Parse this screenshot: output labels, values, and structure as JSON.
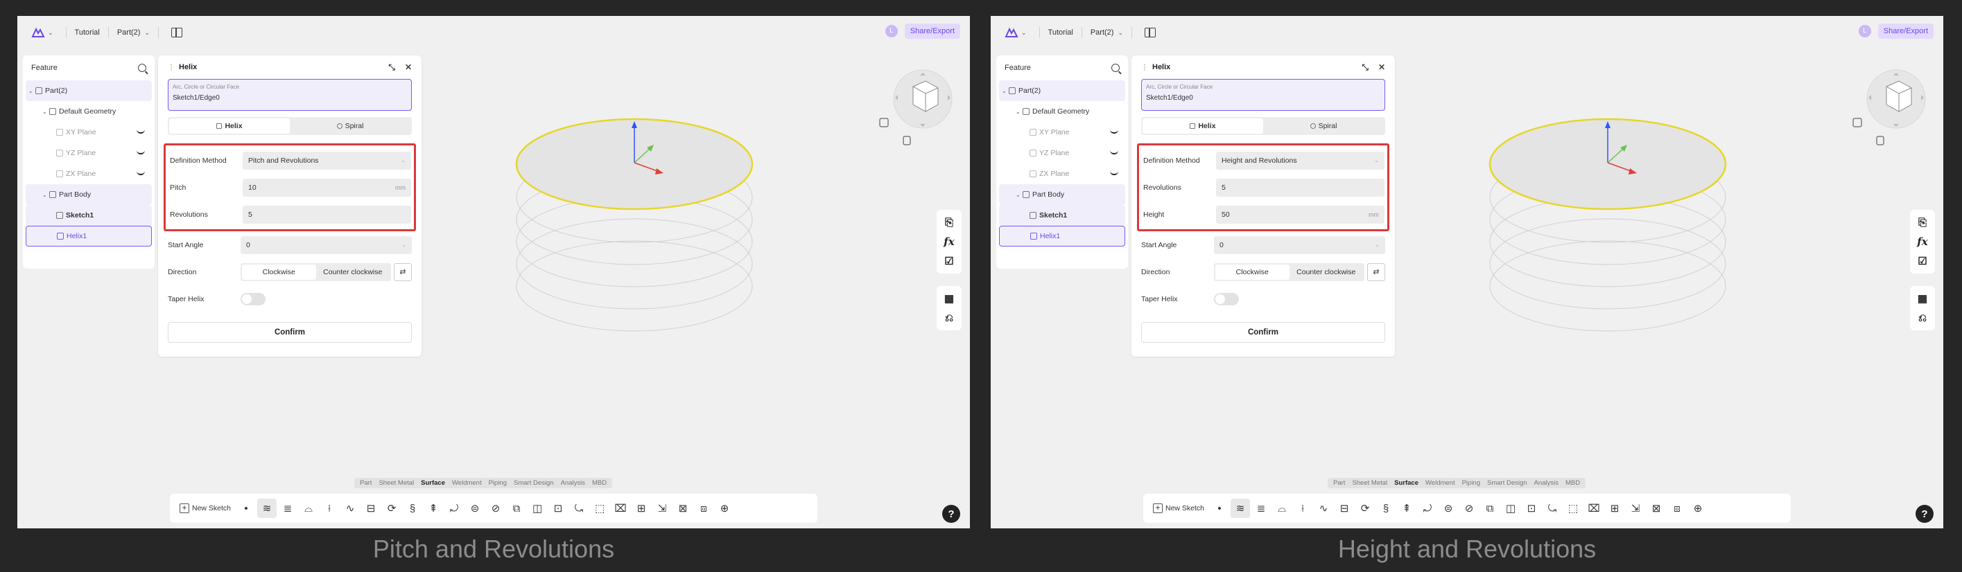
{
  "panels": [
    {
      "caption": "Pitch and Revolutions",
      "topbar": {
        "project": "Tutorial",
        "part": "Part(2)",
        "share_label": "Share/Export",
        "avatar_initial": "L"
      },
      "feature_panel": {
        "title": "Feature",
        "items": [
          {
            "label": "Part(2)"
          },
          {
            "label": "Default Geometry"
          },
          {
            "label": "XY Plane"
          },
          {
            "label": "YZ Plane"
          },
          {
            "label": "ZX Plane"
          },
          {
            "label": "Part Body"
          },
          {
            "label": "Sketch1"
          },
          {
            "label": "Helix1"
          }
        ]
      },
      "dialog": {
        "title": "Helix",
        "face_label": "Arc, Circle or Circular Face",
        "face_value": "Sketch1/Edge0",
        "mode_helix": "Helix",
        "mode_spiral": "Spiral",
        "definition_label": "Definition Method",
        "definition_value": "Pitch and Revolutions",
        "field1_label": "Pitch",
        "field1_value": "10",
        "field1_unit": "mm",
        "field2_label": "Revolutions",
        "field2_value": "5",
        "field2_unit": "",
        "start_angle_label": "Start Angle",
        "start_angle_value": "0",
        "direction_label": "Direction",
        "clockwise": "Clockwise",
        "counter_clockwise": "Counter clockwise",
        "taper_label": "Taper Helix",
        "confirm": "Confirm"
      },
      "module_tabs": [
        "Part",
        "Sheet Metal",
        "Surface",
        "Weldment",
        "Piping",
        "Smart Design",
        "Analysis",
        "MBD"
      ],
      "active_module": "Surface",
      "new_sketch": "New Sketch"
    },
    {
      "caption": "Height and Revolutions",
      "topbar": {
        "project": "Tutorial",
        "part": "Part(2)",
        "share_label": "Share/Export",
        "avatar_initial": "L"
      },
      "feature_panel": {
        "title": "Feature",
        "items": [
          {
            "label": "Part(2)"
          },
          {
            "label": "Default Geometry"
          },
          {
            "label": "XY Plane"
          },
          {
            "label": "YZ Plane"
          },
          {
            "label": "ZX Plane"
          },
          {
            "label": "Part Body"
          },
          {
            "label": "Sketch1"
          },
          {
            "label": "Helix1"
          }
        ]
      },
      "dialog": {
        "title": "Helix",
        "face_label": "Arc, Circle or Circular Face",
        "face_value": "Sketch1/Edge0",
        "mode_helix": "Helix",
        "mode_spiral": "Spiral",
        "definition_label": "Definition Method",
        "definition_value": "Height and Revolutions",
        "field1_label": "Revolutions",
        "field1_value": "5",
        "field1_unit": "",
        "field2_label": "Height",
        "field2_value": "50",
        "field2_unit": "mm",
        "start_angle_label": "Start Angle",
        "start_angle_value": "0",
        "direction_label": "Direction",
        "clockwise": "Clockwise",
        "counter_clockwise": "Counter clockwise",
        "taper_label": "Taper Helix",
        "confirm": "Confirm"
      },
      "module_tabs": [
        "Part",
        "Sheet Metal",
        "Surface",
        "Weldment",
        "Piping",
        "Smart Design",
        "Analysis",
        "MBD"
      ],
      "active_module": "Surface",
      "new_sketch": "New Sketch"
    }
  ],
  "colors": {
    "accent": "#6b46e8",
    "highlight": "#d9393b",
    "edge": "#e6d62a"
  }
}
